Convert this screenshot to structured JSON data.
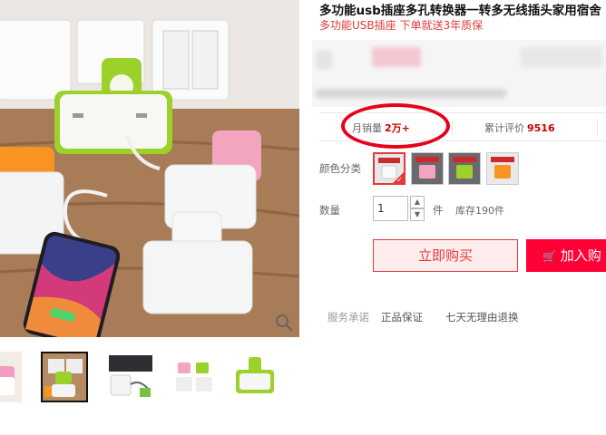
{
  "product": {
    "title": "多功能usb插座多孔转换器一转多无线插头家用宿舍",
    "subtitle": "多功能USB插座 下单就送3年质保"
  },
  "stats": {
    "monthly_sales_label": "月销量",
    "monthly_sales_value": "2万+",
    "reviews_label": "累计评价",
    "reviews_value": "9516"
  },
  "options": {
    "color_label": "颜色分类",
    "color_swatch_count": 4,
    "selected_swatch": 1
  },
  "quantity": {
    "label": "数量",
    "value": "1",
    "unit": "件",
    "stock": "库存190件",
    "up_symbol": "▲",
    "down_symbol": "▼"
  },
  "actions": {
    "buy_now": "立即购买",
    "add_to_cart": "加入购",
    "cart_icon_glyph": "🛒"
  },
  "services": {
    "label": "服务承诺",
    "items": [
      "正品保证",
      "七天无理由退换"
    ]
  },
  "icons": {
    "zoom": "magnifier-icon",
    "cart": "cart-icon",
    "stepper_up": "chevron-up-icon",
    "stepper_down": "chevron-down-icon"
  },
  "colors": {
    "accent_red": "#e4393c",
    "cart_red": "#ff0036",
    "annotation_red": "#e8001a"
  }
}
